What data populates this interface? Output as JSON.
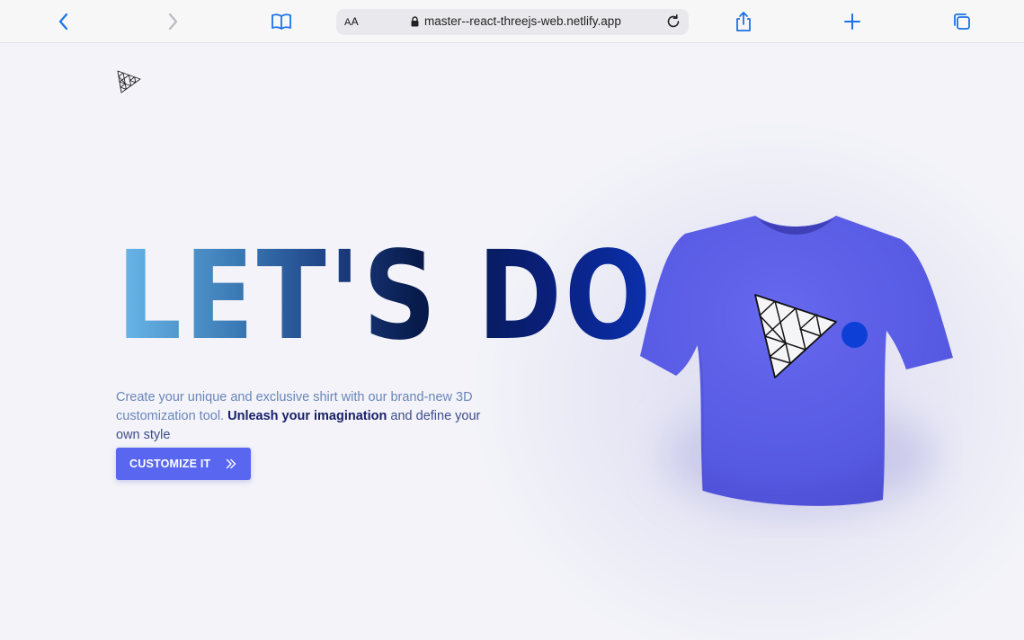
{
  "browser": {
    "reader_label_small": "A",
    "reader_label_big": "A",
    "url": "master--react-threejs-web.netlify.app"
  },
  "hero": {
    "headline": "LET'S DO IT",
    "intro_parts": [
      "Create your unique and exclusive shirt with our brand-new 3D customization tool. ",
      "Unleash your imagination",
      " and define your own style"
    ],
    "cta_label": "CUSTOMIZE IT"
  },
  "colors": {
    "accent": "#5966f0",
    "shirt": "#5a5de6",
    "headline_dark": "#071a4a",
    "dot": "#0d3fd6"
  },
  "icons": {
    "back": "chevron-left-icon",
    "forward": "chevron-right-icon",
    "bookmarks": "open-book-icon",
    "share": "share-icon",
    "new_tab": "plus-icon",
    "tabs": "tabs-icon",
    "logo": "threejs-logo",
    "cta": "double-chevron-right-icon"
  }
}
